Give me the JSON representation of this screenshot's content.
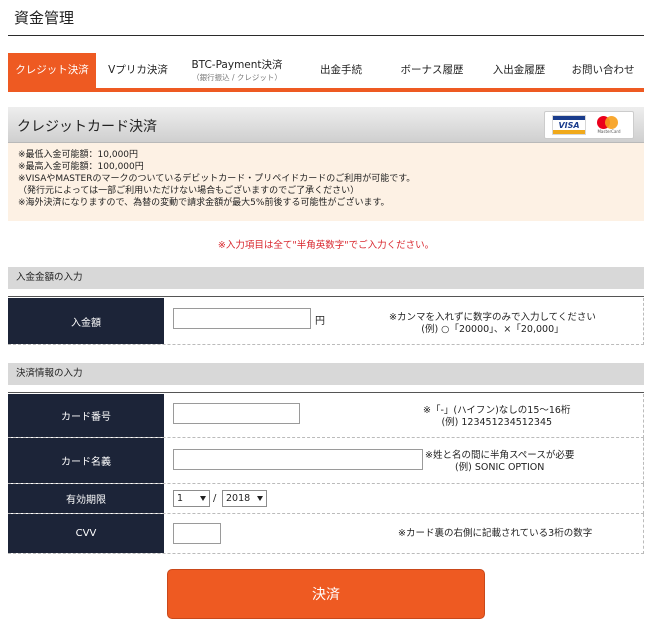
{
  "page": {
    "title": "資金管理"
  },
  "tabs": [
    {
      "label": "クレジット決済",
      "sub": ""
    },
    {
      "label": "Vプリカ決済",
      "sub": ""
    },
    {
      "label": "BTC-Payment決済",
      "sub": "（銀行振込 / クレジット）"
    },
    {
      "label": "出金手続",
      "sub": ""
    },
    {
      "label": "ボーナス履歴",
      "sub": ""
    },
    {
      "label": "入出金履歴",
      "sub": ""
    },
    {
      "label": "お問い合わせ",
      "sub": ""
    }
  ],
  "card_header": {
    "title": "クレジットカード決済",
    "visa_text": "VISA",
    "mc_text": "MasterCard"
  },
  "notice": {
    "min_deposit": "※最低入金可能額：10,000円",
    "max_deposit": "※最高入金可能額：100,000円",
    "card_types": "※VISAやMASTERのマークのついているデビットカード・プリペイドカードのご利用が可能です。",
    "card_types_note": "（発行元によっては一部ご利用いただけない場合もございますのでご了承ください）",
    "overseas": "※海外決済になりますので、為替の変動で請求金額が最大5%前後する可能性がございます。"
  },
  "half_width_notice": "※入力項目は全て\"半角英数字\"でご入力ください。",
  "section_amount": {
    "title": "入金金額の入力",
    "label": "入金額",
    "value": "",
    "unit": "円",
    "hint1": "※カンマを入れずに数字のみで入力してください",
    "hint2": "(例) ○「20000」、×「20,000」"
  },
  "section_payment": {
    "title": "決済情報の入力",
    "card_number": {
      "label": "カード番号",
      "value": "",
      "hint1": "※「-」(ハイフン)なしの15～16桁",
      "hint2": "(例) 123451234512345"
    },
    "card_name": {
      "label": "カード名義",
      "value": "",
      "hint1": "※姓と名の間に半角スペースが必要",
      "hint2": "(例) SONIC OPTION"
    },
    "expiry": {
      "label": "有効期限",
      "month": "1",
      "year": "2018",
      "separator": "/"
    },
    "cvv": {
      "label": "CVV",
      "value": "",
      "hint": "※カード裏の右側に記載されている3桁の数字"
    }
  },
  "submit": {
    "label": "決済"
  },
  "colors": {
    "accent": "#ee5a22",
    "label_bg": "#1c2438",
    "notice_bg": "#fdf1e4",
    "alert": "#d9272e"
  }
}
